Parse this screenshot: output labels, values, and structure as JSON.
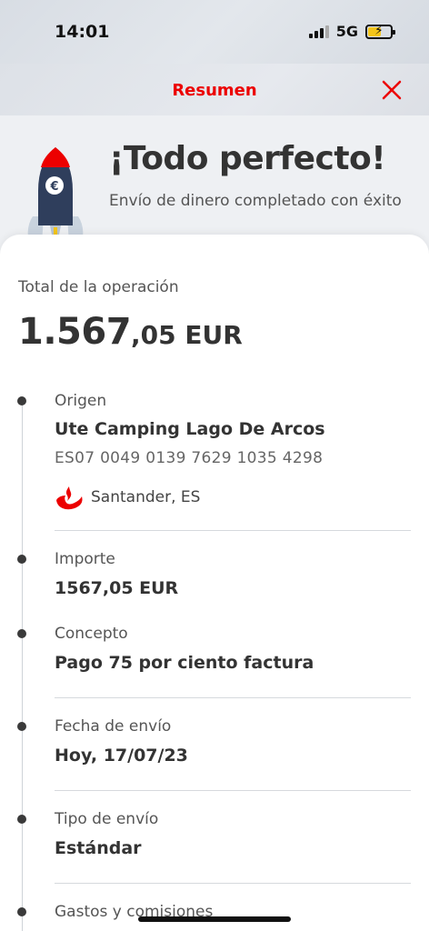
{
  "status_bar": {
    "time": "14:01",
    "network": "5G"
  },
  "header": {
    "title": "Resumen"
  },
  "hero": {
    "title": "¡Todo perfecto!",
    "subtitle": "Envío de dinero completado con éxito"
  },
  "total": {
    "label": "Total de la operación",
    "amount_integer": "1.567",
    "amount_decimal": ",05 EUR"
  },
  "origin": {
    "label": "Origen",
    "name": "Ute Camping Lago De Arcos",
    "iban": "ES07 0049 0139 7629 1035 4298",
    "bank": "Santander, ES"
  },
  "amount": {
    "label": "Importe",
    "value": "1567,05 EUR"
  },
  "concept": {
    "label": "Concepto",
    "value": "Pago 75 por ciento factura"
  },
  "send_date": {
    "label": "Fecha de envío",
    "value": "Hoy, 17/07/23"
  },
  "send_type": {
    "label": "Tipo de envío",
    "value": "Estándar"
  },
  "fees": {
    "label": "Gastos y comisiones"
  },
  "colors": {
    "brand_red": "#ec0000",
    "rocket_body": "#2f3e5c",
    "text": "#333333"
  }
}
